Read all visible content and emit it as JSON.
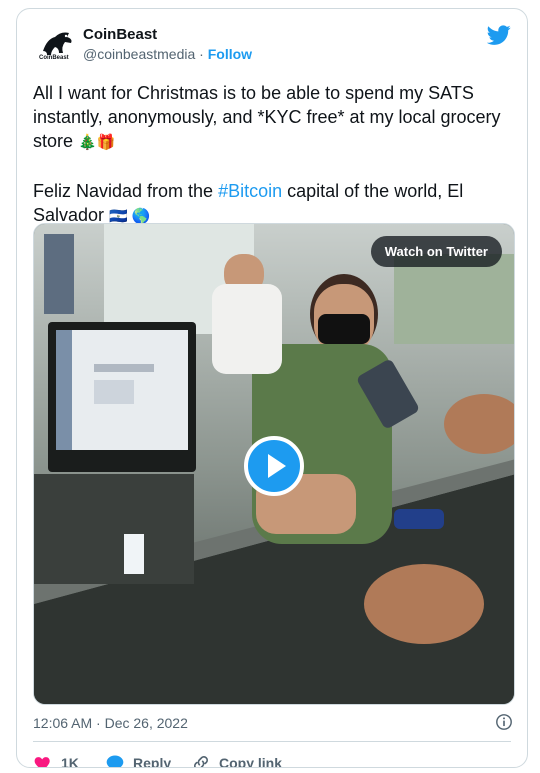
{
  "author": {
    "name": "CoinBeast",
    "handle": "@coinbeastmedia",
    "separator": "·",
    "follow_label": "Follow",
    "avatar_text": "CoinBeast"
  },
  "tweet": {
    "line1": "All I want for Christmas is to be able to spend my SATS instantly, anonymously, and *KYC free* at my local grocery store",
    "line1_emoji": "🎄🎁",
    "line2_pre": "Feliz Navidad from the ",
    "hashtag": "#Bitcoin",
    "line2_post": " capital of the world, El Salvador",
    "line2_emoji": "🇸🇻 🌎"
  },
  "media": {
    "watch_label": "Watch on Twitter"
  },
  "timestamp": "12:06 AM · Dec 26, 2022",
  "actions": {
    "likes": "1K",
    "reply": "Reply",
    "copy": "Copy link"
  },
  "colors": {
    "accent": "#1d9bf0",
    "like": "#f91880",
    "text": "#0f1419",
    "muted": "#536471"
  }
}
